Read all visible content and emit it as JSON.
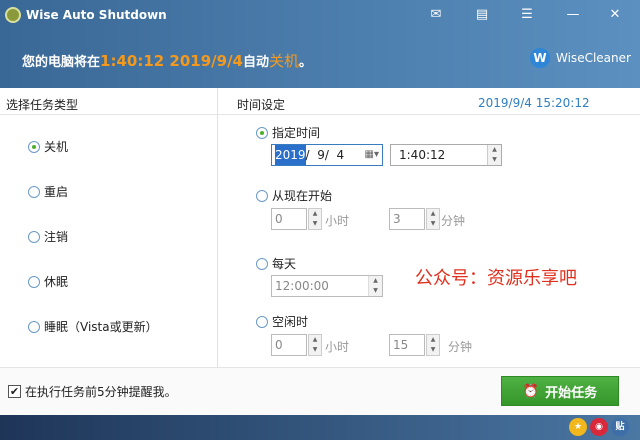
{
  "window": {
    "title": "Wise Auto Shutdown"
  },
  "header": {
    "prefix": "您的电脑将在",
    "time": "1:40:12 2019/9/4",
    "mid": "自动",
    "action": "关机",
    "suffix": "。",
    "brand": "WiseCleaner",
    "brand_logo": "W"
  },
  "sections": {
    "left_title": "选择任务类型",
    "right_title": "时间设定",
    "current_time": "2019/9/4 15:20:12"
  },
  "task_types": [
    {
      "label": "关机",
      "selected": true
    },
    {
      "label": "重启",
      "selected": false
    },
    {
      "label": "注销",
      "selected": false
    },
    {
      "label": "休眠",
      "selected": false
    },
    {
      "label": "睡眠（Vista或更新）",
      "selected": false
    }
  ],
  "time": {
    "specified": {
      "label": "指定时间",
      "date_year": "2019",
      "date_rest": "/  9/  4",
      "time": "1:40:12"
    },
    "from_now": {
      "label": "从现在开始",
      "hours": "0",
      "hours_unit": "小时",
      "minutes": "3",
      "minutes_unit": "分钟"
    },
    "daily": {
      "label": "每天",
      "time": "12:00:00"
    },
    "idle": {
      "label": "空闲时",
      "hours": "0",
      "hours_unit": "小时",
      "minutes": "15",
      "minutes_unit": "分钟"
    }
  },
  "watermark": "公众号：资源乐享吧",
  "bottom": {
    "remind_label": "在执行任务前5分钟提醒我。",
    "remind_checked": true,
    "start_label": "开始任务"
  },
  "footer_icons": [
    "star-icon",
    "weibo-icon",
    "tieba-icon"
  ],
  "footer_icon_labels": {
    "tieba": "贴"
  }
}
